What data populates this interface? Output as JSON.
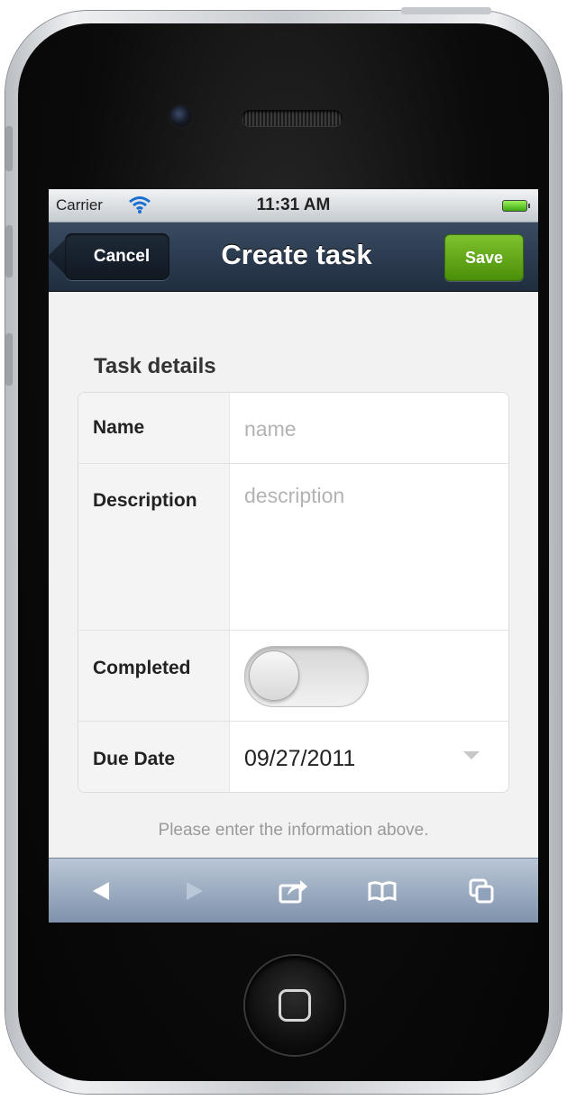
{
  "status_bar": {
    "carrier": "Carrier",
    "time": "11:31 AM",
    "wifi_icon": "wifi-icon",
    "battery_icon": "battery-icon"
  },
  "nav": {
    "cancel_label": "Cancel",
    "title": "Create task",
    "save_label": "Save"
  },
  "form": {
    "section_title": "Task details",
    "name": {
      "label": "Name",
      "placeholder": "name",
      "value": ""
    },
    "description": {
      "label": "Description",
      "placeholder": "description",
      "value": ""
    },
    "completed": {
      "label": "Completed",
      "on": false
    },
    "due_date": {
      "label": "Due Date",
      "value": "09/27/2011"
    }
  },
  "footer_note": "Please enter the information above.",
  "toolbar": {
    "items": [
      "back-icon",
      "forward-icon",
      "share-icon",
      "bookmarks-icon",
      "tabs-icon"
    ]
  },
  "colors": {
    "nav_bar": "#2c3b4f",
    "save_green": "#62a81c",
    "toolbar": "#9aabc2"
  }
}
